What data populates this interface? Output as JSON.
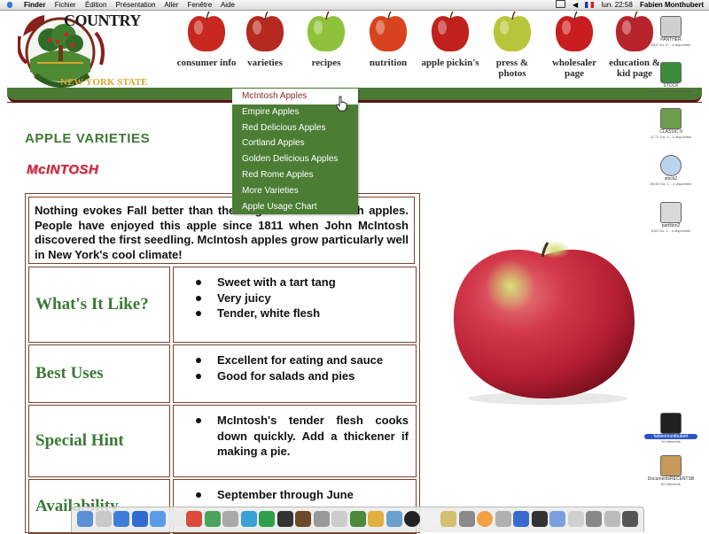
{
  "menubar": {
    "app": "Finder",
    "menus": [
      "Fichier",
      "Édition",
      "Présentation",
      "Aller",
      "Fenêtre",
      "Aide"
    ],
    "time": "lun. 22:58",
    "user": "Fabien Monthubert"
  },
  "site": {
    "logo_word": "COUNTRY",
    "logo_state": "NEW YORK STATE",
    "nav": [
      {
        "label": "consumer info",
        "color": "#c8281f"
      },
      {
        "label": "varieties",
        "color": "#b52a20"
      },
      {
        "label": "recipes",
        "color": "#8fc23a"
      },
      {
        "label": "nutrition",
        "color": "#d9441f"
      },
      {
        "label": "apple pickin's",
        "color": "#c0211c"
      },
      {
        "label": "press & photos",
        "color": "#b8c53a"
      },
      {
        "label": "wholesaler page",
        "color": "#c91e20"
      },
      {
        "label": "education & kid page",
        "color": "#b8242c"
      }
    ]
  },
  "dropdown": {
    "items": [
      "McIntosh Apples",
      "Empire Apples",
      "Red Delicious Apples",
      "Cortland Apples",
      "Golden Delicious Apples",
      "Red Rome Apples",
      "More Varieties",
      "Apple Usage Chart"
    ],
    "active_index": 0
  },
  "page": {
    "section_title": "APPLE VARIETIES",
    "variety_title": "McINTOSH",
    "intro": "Nothing evokes Fall better than the fragrance of McIntosh apples. People have enjoyed this apple since 1811 when John McIntosh discovered the first seedling. McIntosh apples grow particularly well in New York's cool climate!",
    "rows": [
      {
        "label": "What's It Like?",
        "items": [
          "Sweet with a tart tang",
          "Very juicy",
          "Tender, white flesh"
        ]
      },
      {
        "label": "Best Uses",
        "items": [
          "Excellent for eating and sauce",
          "Good for salads and pies"
        ]
      },
      {
        "label": "Special Hint",
        "items": [
          "McIntosh's tender flesh cooks down quickly. Add a thickener if making a pie."
        ]
      },
      {
        "label": "Availability",
        "items": [
          "September through June"
        ]
      }
    ]
  },
  "desktop": [
    {
      "name": "PANTHER",
      "sub": "65,6 Go, 5... o disponible"
    },
    {
      "name": "STOCK",
      "sub": "61,6 Go, 1,3 Go disponible"
    },
    {
      "name": "CLASSIC 9",
      "sub": "11,71 Go, 1... o disponible"
    },
    {
      "name": "stock2",
      "sub": "60,69 Go, 1... o disponible"
    },
    {
      "name": "partition2",
      "sub": "8,69 Go, 1... o disponible"
    },
    {
      "name": "fabienmonthubert",
      "sub": "10 éléments"
    },
    {
      "name": "DocumentsRECENTSB",
      "sub": "50 éléments"
    }
  ]
}
